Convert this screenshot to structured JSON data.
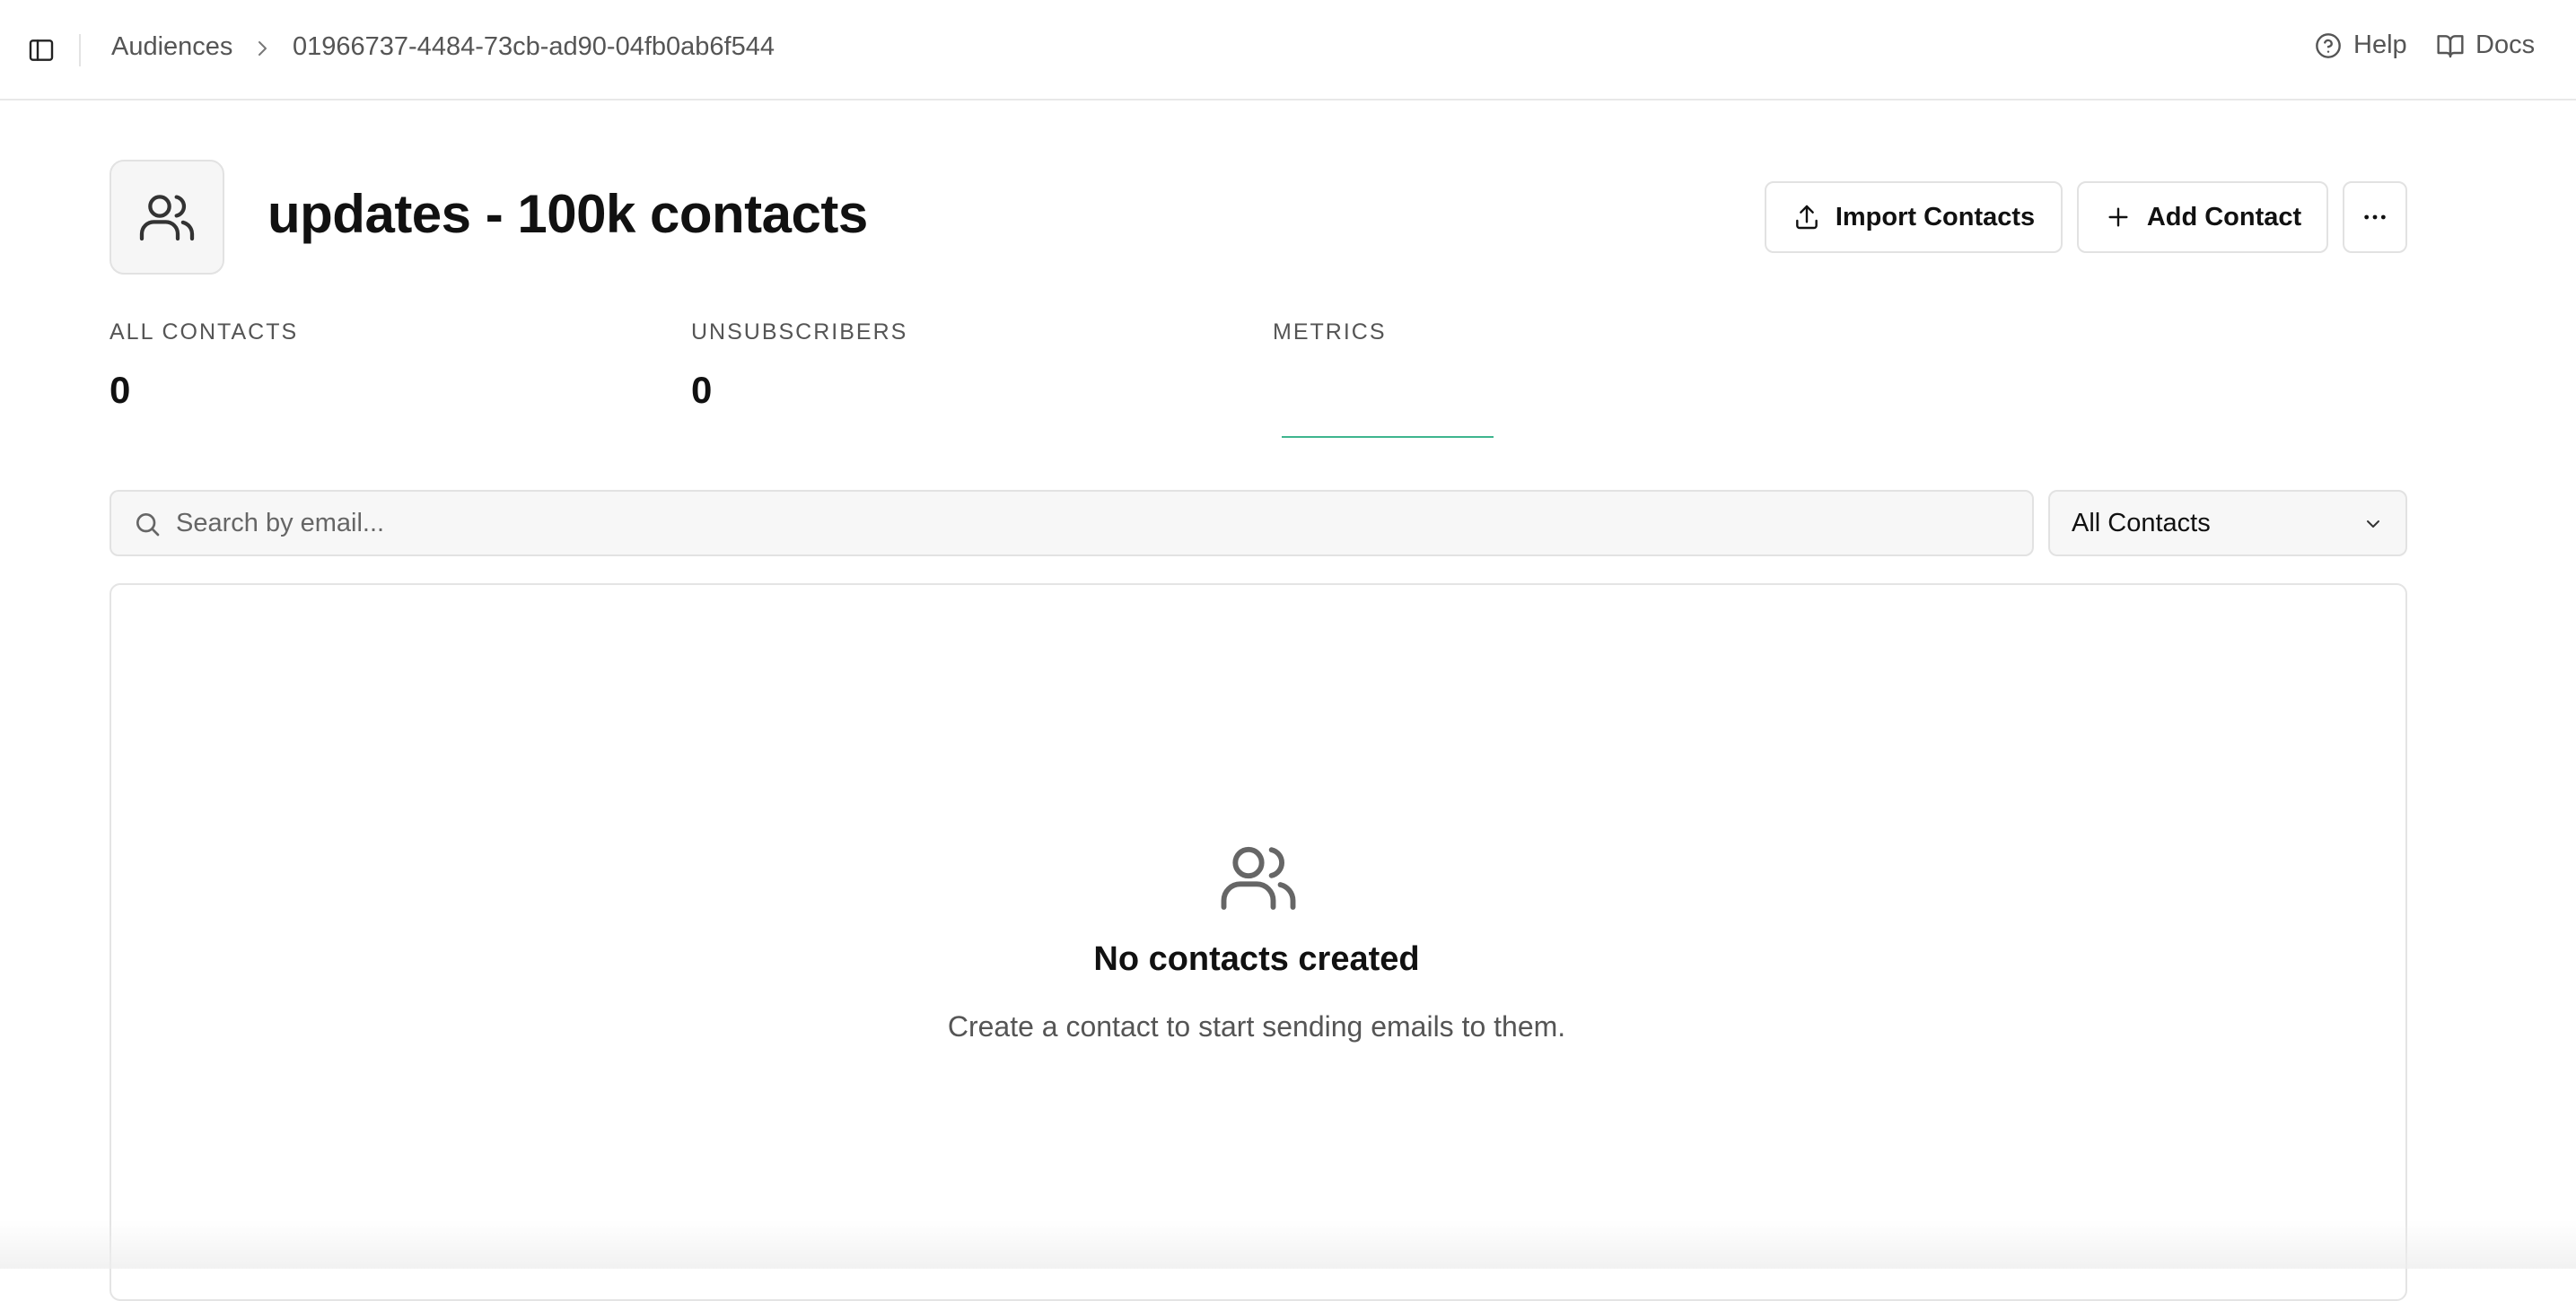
{
  "breadcrumb": {
    "root": "Audiences",
    "current": "01966737-4484-73cb-ad90-04fb0ab6f544"
  },
  "topnav": {
    "help": "Help",
    "docs": "Docs"
  },
  "header": {
    "title": "updates - 100k contacts",
    "import_label": "Import Contacts",
    "add_label": "Add Contact",
    "more_label": "···"
  },
  "stats": {
    "all_contacts_label": "ALL CONTACTS",
    "all_contacts_value": "0",
    "unsubscribers_label": "UNSUBSCRIBERS",
    "unsubscribers_value": "0",
    "metrics_label": "METRICS"
  },
  "filters": {
    "search_placeholder": "Search by email...",
    "search_value": "",
    "segment_selected": "All Contacts"
  },
  "empty_state": {
    "title": "No contacts created",
    "subtitle": "Create a contact to start sending emails to them."
  },
  "colors": {
    "accent": "#3fb58e",
    "border": "#e2e2e2",
    "muted_text": "#555555"
  }
}
